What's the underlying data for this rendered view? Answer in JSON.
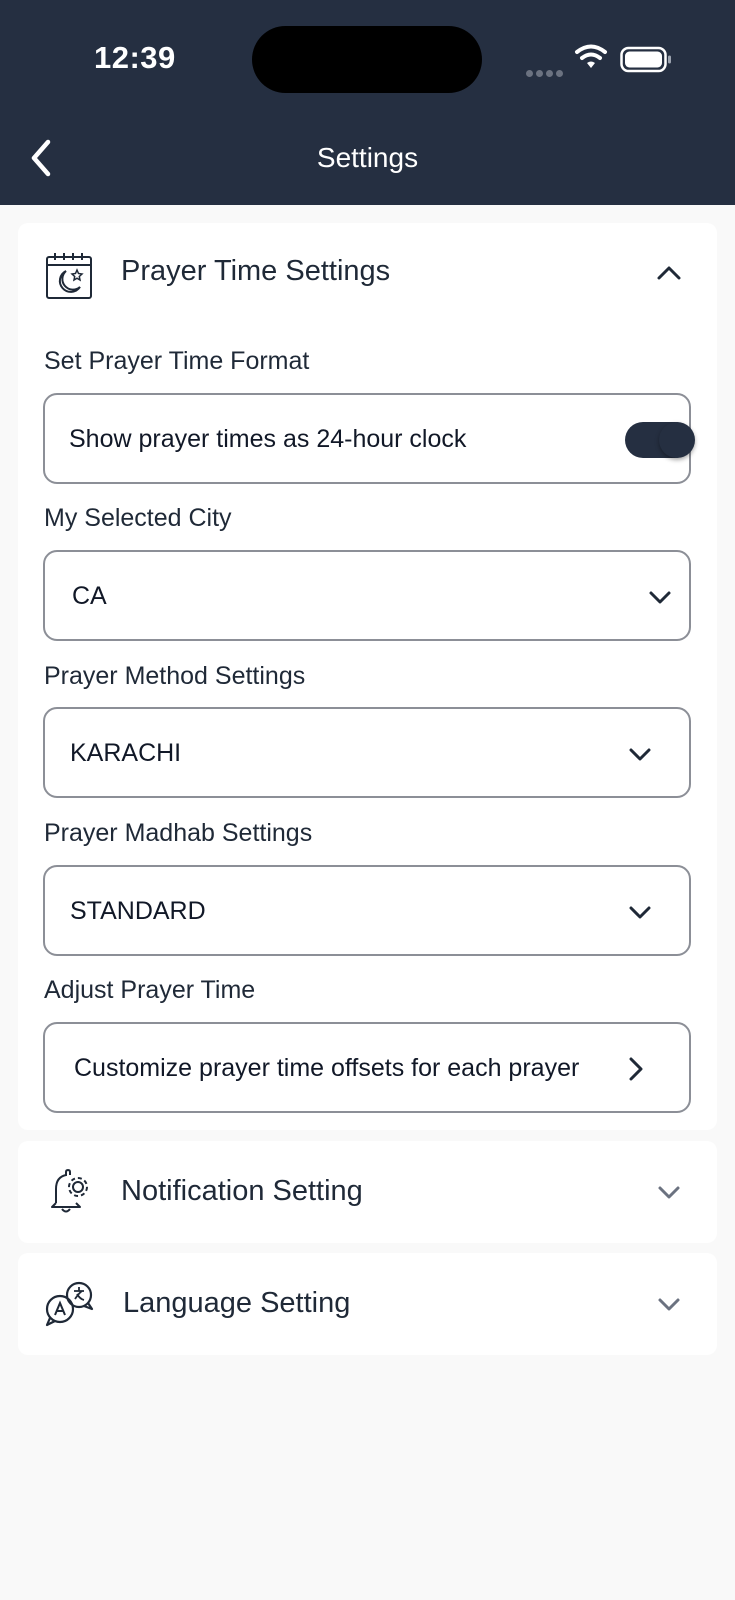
{
  "status_bar": {
    "time": "12:39"
  },
  "header": {
    "title": "Settings",
    "back_icon": "chevron-left-icon"
  },
  "colors": {
    "header_bg": "#252f41",
    "page_bg": "#f9f9f9",
    "card_bg": "#ffffff",
    "toggle_on": "#252f41"
  },
  "prayer_section": {
    "title": "Prayer Time Settings",
    "icon": "calendar-moon-icon",
    "expanded": true,
    "format": {
      "label": "Set Prayer Time Format",
      "toggle_text": "Show prayer times as 24-hour clock",
      "toggle_on": true
    },
    "city": {
      "label": "My Selected City",
      "value": "CA"
    },
    "method": {
      "label": "Prayer Method Settings",
      "value": "KARACHI"
    },
    "madhab": {
      "label": "Prayer Madhab Settings",
      "value": "STANDARD"
    },
    "adjust": {
      "label": "Adjust Prayer Time",
      "value": "Customize prayer time offsets for each prayer"
    }
  },
  "notification_section": {
    "title": "Notification Setting",
    "icon": "bell-gear-icon",
    "expanded": false
  },
  "language_section": {
    "title": "Language Setting",
    "icon": "language-bubbles-icon",
    "expanded": false
  }
}
